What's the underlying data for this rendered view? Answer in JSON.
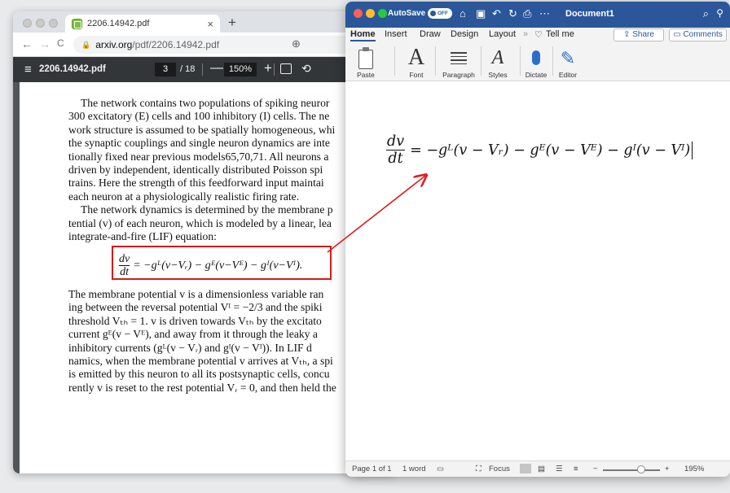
{
  "browser": {
    "tab_title": "2206.14942.pdf",
    "tab_close": "×",
    "new_tab": "+",
    "url_host": "arxiv.org",
    "url_path": "/pdf/2206.14942.pdf",
    "back": "←",
    "forward": "→",
    "reload": "C",
    "lock": "🔒",
    "zoom_icon": "⊕"
  },
  "pdf_toolbar": {
    "menu_icon": "≡",
    "file_name": "2206.14942.pdf",
    "current_page": "3",
    "total_pages": "/ 18",
    "zoom_minus": "—",
    "zoom": "150%",
    "zoom_plus": "+",
    "rotate_icon": "⟲"
  },
  "pdf_page": {
    "para1_lines": [
      "The network contains two populations of spiking neuror",
      "300 excitatory (E) cells and 100 inhibitory (I) cells.  The ne",
      "work structure is assumed to be spatially homogeneous, whi",
      "the synaptic couplings and single neuron dynamics are inte",
      "tionally fixed near previous models65,70,71.  All neurons a",
      "driven by independent, identically distributed Poisson spi",
      "trains.  Here the strength of this feedforward input maintai",
      "each neuron at a physiologically realistic firing rate."
    ],
    "para2_lines": [
      "The network dynamics is determined by the membrane p",
      "tential (v) of each neuron, which is modeled by a linear, lea",
      "integrate-and-fire (LIF) equation:"
    ],
    "equation": "dv/dt = −g^L(v−V_r) − g^E(v−V^E) − g^I(v−V^I).",
    "equation_lhs_num": "dv",
    "equation_lhs_den": "dt",
    "equation_rhs": "= −gᴸ(v−Vᵣ) − gᴱ(v−Vᴱ) − gᴵ(v−Vᴵ).",
    "equation_number": "(",
    "para3_lines": [
      "The membrane potential v is a dimensionless variable ran",
      "ing between the reversal potential Vᴵ = −2/3 and the spiki",
      "threshold Vₜₕ = 1.  v is driven towards Vₜₕ by the excitato",
      "current gᴱ(v − Vᴱ), and away from it through the leaky a",
      "inhibitory currents (gᴸ(v − Vᵣ) and gᴵ(v − Vᴵ)).  In LIF d",
      "namics, when the membrane potential v arrives at Vₜₕ, a spi",
      "is emitted by this neuron to all its postsynaptic cells, concu",
      "rently v is reset to the rest potential Vᵣ = 0, and then held the"
    ]
  },
  "word": {
    "autosave_label": "AutoSave",
    "autosave_state": "OFF",
    "doc_title": "Document1",
    "tabs": [
      "Home",
      "Insert",
      "Draw",
      "Design",
      "Layout",
      "»",
      "Tell me"
    ],
    "share": "Share",
    "comments": "Comments",
    "ribbon": {
      "paste": "Paste",
      "font": "Font",
      "paragraph": "Paragraph",
      "styles": "Styles",
      "dictate": "Dictate",
      "editor": "Editor"
    },
    "equation_num": "dv",
    "equation_den": "dt",
    "equation_rhs": "= −gᴸ(v − Vᵣ) − gᴱ(v − Vᴱ) − gᴵ(v − Vᴵ)",
    "status": {
      "page": "Page 1 of 1",
      "words": "1 word",
      "focus": "Focus",
      "zoom": "195%",
      "minus": "−",
      "plus": "+"
    }
  },
  "colors": {
    "word_blue": "#2b579a",
    "highlight_red": "#d41b1b",
    "pdf_toolbar": "#323639"
  }
}
